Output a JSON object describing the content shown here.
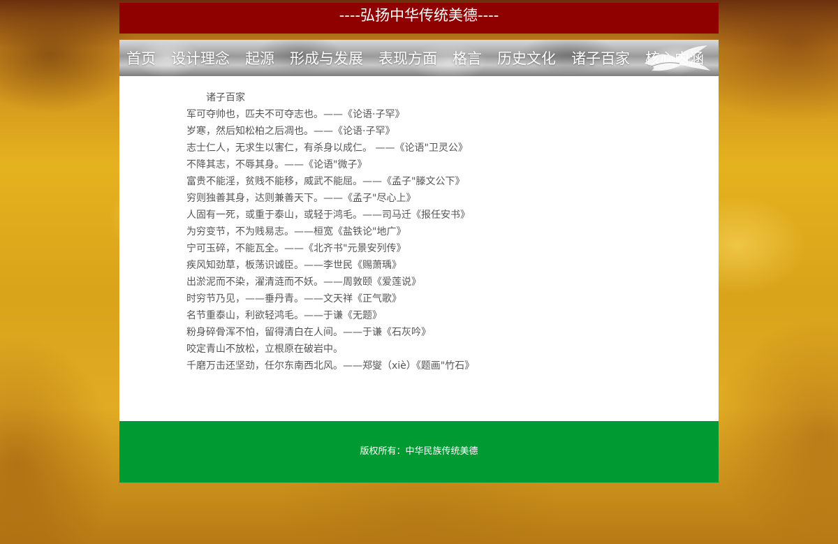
{
  "header": {
    "banner_text": "----弘扬中华传统美德----"
  },
  "nav": {
    "items": [
      {
        "label": "首页"
      },
      {
        "label": "设计理念"
      },
      {
        "label": "起源"
      },
      {
        "label": "形成与发展"
      },
      {
        "label": "表现方面"
      },
      {
        "label": "格言"
      },
      {
        "label": "历史文化"
      },
      {
        "label": "诸子百家"
      },
      {
        "label": "核心内涵"
      }
    ],
    "decoration_icon": "crane-icon"
  },
  "main": {
    "title": "诸子百家",
    "lines": [
      "军可夺帅也，匹夫不可夺志也。——《论语·子罕》",
      "岁寒，然后知松柏之后凋也。——《论语·子罕》",
      "志士仁人，无求生以害仁，有杀身以成仁。 ——《论语\"卫灵公》",
      "不降其志，不辱其身。——《论语\"微子》",
      "富贵不能淫，贫贱不能移，威武不能屈。——《孟子\"滕文公下》",
      "穷则独善其身，达则兼善天下。——《孟子\"尽心上》",
      "人固有一死，或重于泰山，或轻于鸿毛。——司马迁《报任安书》",
      "为穷变节，不为贱易志。——桓宽《盐铁论\"地广》",
      "宁可玉碎，不能瓦全。——《北齐书\"元景安列传》",
      "疾风知劲草，板荡识诚臣。——李世民《赐萧瑀》",
      "出淤泥而不染，濯清涟而不妖。——周敦颐《爱莲说》",
      "时穷节乃见，——垂丹青。——文天祥《正气歌》",
      "名节重泰山，利欲轻鸿毛。——于谦《无题》",
      "粉身碎骨浑不怕，留得清白在人间。——于谦《石灰吟》",
      "咬定青山不放松，立根原在破岩中。",
      "千磨万击还坚劲，任尔东南西北风。——郑燮（xiè）《题画\"竹石》"
    ]
  },
  "footer": {
    "copyright": "版权所有：中华民族传统美德"
  },
  "colors": {
    "banner_bg": "#8f0000",
    "footer_bg": "#009a33",
    "content_bg": "#ffffff",
    "text": "#555555"
  }
}
